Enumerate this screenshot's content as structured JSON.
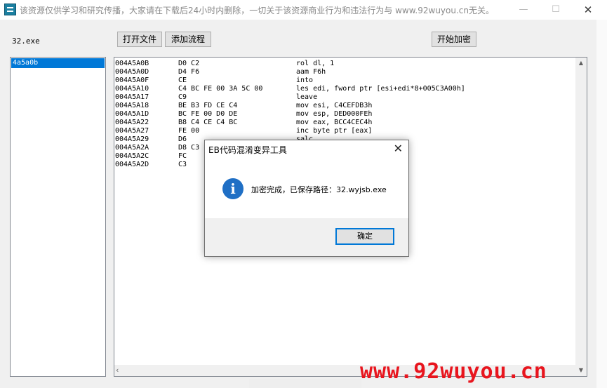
{
  "window": {
    "title": "该资源仅供学习和研究传播，大家请在下载后24小时内删除，一切关于该资源商业行为和违法行为与 www.92wuyou.cn无关。",
    "min_symbol": "—",
    "max_symbol": "☐",
    "close_symbol": "✕"
  },
  "toolbar": {
    "filename": "32.exe",
    "open_label": "打开文件",
    "add_label": "添加流程",
    "encrypt_label": "开始加密"
  },
  "list": {
    "items": [
      "4a5a0b"
    ]
  },
  "code": {
    "rows": [
      {
        "addr": "004A5A0B",
        "hex": "D0 C2",
        "asm": "rol dl, 1"
      },
      {
        "addr": "004A5A0D",
        "hex": "D4 F6",
        "asm": "aam F6h"
      },
      {
        "addr": "004A5A0F",
        "hex": "CE",
        "asm": "into"
      },
      {
        "addr": "004A5A10",
        "hex": "C4 BC FE 00 3A 5C 00",
        "asm": "les edi, fword ptr [esi+edi*8+005C3A00h]"
      },
      {
        "addr": "004A5A17",
        "hex": "C9",
        "asm": "leave"
      },
      {
        "addr": "004A5A18",
        "hex": "BE B3 FD CE C4",
        "asm": "mov esi, C4CEFDB3h"
      },
      {
        "addr": "004A5A1D",
        "hex": "BC FE 00 D0 DE",
        "asm": "mov esp, DED000FEh"
      },
      {
        "addr": "004A5A22",
        "hex": "B8 C4 CE C4 BC",
        "asm": "mov eax, BCC4CEC4h"
      },
      {
        "addr": "004A5A27",
        "hex": "FE 00",
        "asm": "inc byte ptr [eax]"
      },
      {
        "addr": "004A5A29",
        "hex": "D6",
        "asm": "salc"
      },
      {
        "addr": "004A5A2A",
        "hex": "D8 C3",
        "asm": ""
      },
      {
        "addr": "004A5A2C",
        "hex": "FC",
        "asm": ""
      },
      {
        "addr": "004A5A2D",
        "hex": "C3",
        "asm": ""
      }
    ]
  },
  "dialog": {
    "title": "EB代码混淆变异工具",
    "message": "加密完成，已保存路径：32.wyjsb.exe",
    "ok_label": "确定",
    "close_symbol": "✕",
    "info_symbol": "i"
  },
  "watermark": {
    "text": "www.92wuyou.cn"
  },
  "colors": {
    "selection": "#0078d7",
    "watermark": "#e8151e",
    "info": "#1f6fc5"
  }
}
